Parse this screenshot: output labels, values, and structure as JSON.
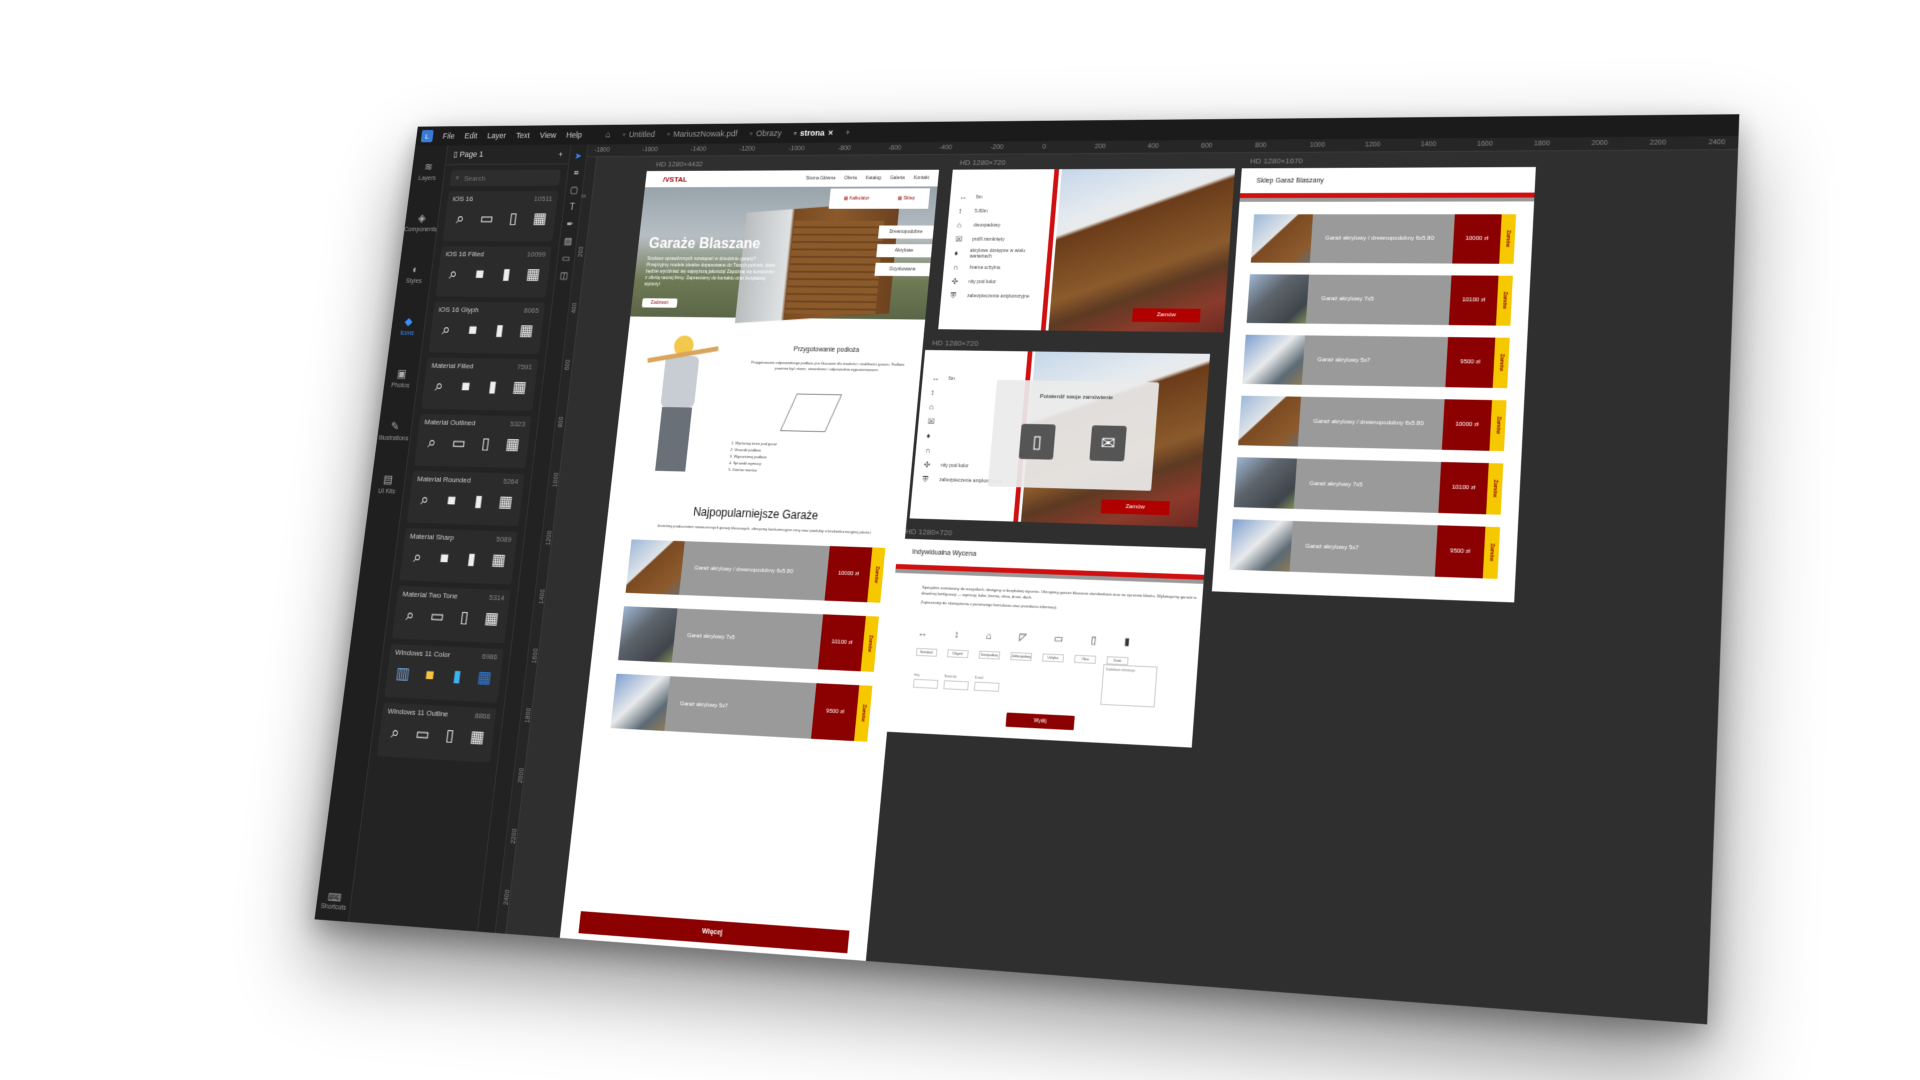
{
  "menu": {
    "items": [
      "File",
      "Edit",
      "Layer",
      "Text",
      "View",
      "Help"
    ]
  },
  "tabs": [
    {
      "label": "Untitled",
      "active": false
    },
    {
      "label": "MariuszNowak.pdf",
      "active": false
    },
    {
      "label": "Obrazy",
      "active": false
    },
    {
      "label": "strona",
      "active": true
    }
  ],
  "ruler": {
    "labels": [
      "-1800",
      "-1600",
      "-1400",
      "-1200",
      "-1000",
      "-800",
      "-600",
      "-400",
      "-200",
      "0",
      "200",
      "400",
      "600",
      "800",
      "1000",
      "1200",
      "1400",
      "1600",
      "1800",
      "2000",
      "2200",
      "2400"
    ]
  },
  "vruler": {
    "labels": [
      "0",
      "200",
      "400",
      "600",
      "800",
      "1000",
      "1200",
      "1400",
      "1600",
      "1800",
      "2000",
      "2200",
      "2400"
    ]
  },
  "rail": {
    "items": [
      {
        "label": "Layers",
        "icon": "layers-icon",
        "active": false
      },
      {
        "label": "Components",
        "icon": "components-icon",
        "active": false
      },
      {
        "label": "Styles",
        "icon": "styles-icon",
        "active": false
      },
      {
        "label": "Icons",
        "icon": "icons-icon",
        "active": true
      },
      {
        "label": "Photos",
        "icon": "photos-icon",
        "active": false
      },
      {
        "label": "Illustrations",
        "icon": "illustrations-icon",
        "active": false
      },
      {
        "label": "UI Kits",
        "icon": "ui-kits-icon",
        "active": false
      }
    ],
    "shortcuts": "Shortcuts"
  },
  "panel": {
    "page": "Page 1",
    "search_placeholder": "Search",
    "iconsets": [
      {
        "name": "iOS 16",
        "count": "10511",
        "glyphs": [
          "⌕",
          "▭",
          "▯",
          "▦"
        ]
      },
      {
        "name": "iOS 16 Filled",
        "count": "10099",
        "glyphs": [
          "⌕",
          "■",
          "▮",
          "▦"
        ]
      },
      {
        "name": "iOS 16 Glyph",
        "count": "8065",
        "glyphs": [
          "⌕",
          "■",
          "▮",
          "▦"
        ]
      },
      {
        "name": "Material Filled",
        "count": "7591",
        "glyphs": [
          "⌕",
          "■",
          "▮",
          "▦"
        ]
      },
      {
        "name": "Material Outlined",
        "count": "5323",
        "glyphs": [
          "⌕",
          "▭",
          "▯",
          "▦"
        ]
      },
      {
        "name": "Material Rounded",
        "count": "5264",
        "glyphs": [
          "⌕",
          "■",
          "▮",
          "▦"
        ]
      },
      {
        "name": "Material Sharp",
        "count": "5089",
        "glyphs": [
          "⌕",
          "■",
          "▮",
          "▦"
        ]
      },
      {
        "name": "Material Two Tone",
        "count": "5314",
        "glyphs": [
          "⌕",
          "▭",
          "▯",
          "▦"
        ]
      },
      {
        "name": "Windows 11 Color",
        "count": "6986",
        "glyphs": [
          "▥",
          "■",
          "▮",
          "▦"
        ]
      },
      {
        "name": "Windows 11 Outline",
        "count": "8868",
        "glyphs": [
          "⌕",
          "▭",
          "▯",
          "▦"
        ]
      }
    ]
  },
  "artboards": {
    "main": {
      "label": "HD 1280×4432",
      "nav": [
        "Strona Główna",
        "Oferta",
        "Katalog",
        "Galeria",
        "Kontakt"
      ],
      "quick": [
        "Kalkulator",
        "Sklep"
      ],
      "side_pills": [
        "Drewnopodobne",
        "Akrylowe",
        "Ocynkowane"
      ],
      "hero_title": "Garaże Blaszane",
      "hero_text": "Szukasz sprawdzonych rozwiązań w dziedzinie garaży? Przejrzyjmy modele idealne dopasowane do Twoich potrzeb, które będzie wyróżniać się najwyższą jakością! Zapoznaj się koniecznie z ofertą naszej firmy. Zapraszamy do kontaktu oraz bezpłatnej wyceny!",
      "hero_btn": "Zadzwoń",
      "prep_title": "Przygotowanie podłoża",
      "prep_text": "Przygotowanie odpowiedniego podłoża jest kluczowe dla trwałości i stabilności garażu. Podłoże powinno być równe, utwardzone i odpowiednio wypoziomowane.",
      "steps": [
        "1. Wyrównaj teren pod garaż",
        "2. Utwardź podłoże",
        "3. Wypoziomuj podłoże",
        "4. Sprawdź wymiary",
        "5. Zamów montaż"
      ],
      "section_title": "Najpopularniejsze Garaże",
      "section_sub": "Jesteśmy producentem nowoczesnych garaży blaszanych, oferujemy konkurencyjne ceny oraz produkty o bezkonkurencyjnej jakości",
      "products": [
        {
          "name": "Garaż akrylowy / drewnopodobny 6x5.80",
          "price": "10000 zł"
        },
        {
          "name": "Garaż akrylowy 7x5",
          "price": "10100 zł"
        },
        {
          "name": "Garaż akrylowy 5x7",
          "price": "9500 zł"
        }
      ],
      "order": "Zamów",
      "more": "Więcej"
    },
    "detail": {
      "label": "HD 1280×720",
      "specs": [
        "6m",
        "5.80m",
        "dwuspadowy",
        "profil zamknięty",
        "akrylowe dostępne w wielu wariantach",
        "brama uchylna",
        "nity pod kolor",
        "zabezpieczenie antykorozyjne"
      ],
      "order": "Zamów"
    },
    "detail2": {
      "label": "HD 1280×720",
      "specs": [
        "6m",
        "",
        "",
        "",
        "",
        "",
        "nity pod kolor",
        "zabezpieczenie antykorozyjne"
      ],
      "modal_title": "Potwierdź swoje zamówienie",
      "order": "Zamów"
    },
    "quote": {
      "label": "HD 1280×720",
      "title": "Indywidualna Wycena",
      "text": "Specjalnie zamówiony do wszystkich, dostępny w bezpłatnej wycenie. Oferujemy garaże blaszane standardowe oraz na życzenie klienta. Wykonujemy garaże w dowolnej konfiguracji — wymiary, kolor, brama, okna, drzwi, dach.",
      "text2": "Zapraszamy do skorzystania z poniższego formularza oraz przesłania informacji.",
      "tags": [
        "Szerokość",
        "Długość",
        "Dwuspadowy",
        "Jednospadowy",
        "Uchylna",
        "Okno",
        "Drzwi"
      ],
      "fields": [
        "Imię",
        "Nazwisko",
        "E-mail"
      ],
      "textarea": "Dodatkowe informacje",
      "send": "Wyślij"
    },
    "shop": {
      "label": "HD 1280×1670",
      "title": "Sklep Garaż Blaszany",
      "products": [
        {
          "name": "Garaż akrylowy / drewnopodobny 6x5.80",
          "price": "10000 zł"
        },
        {
          "name": "Garaż akrylowy 7x5",
          "price": "10100 zł"
        },
        {
          "name": "Garaż akrylowy 5x7",
          "price": "9500 zł"
        },
        {
          "name": "Garaż akrylowy / drewnopodobny 6x5.80",
          "price": "10000 zł"
        },
        {
          "name": "Garaż akrylowy 7x5",
          "price": "10100 zł"
        },
        {
          "name": "Garaż akrylowy 5x7",
          "price": "9500 zł"
        }
      ],
      "order": "Zamów"
    }
  },
  "colors": {
    "brand": "#8b0000",
    "accent": "#d01010",
    "order_tag": "#f5c800",
    "canvas": "#2f2f2f"
  }
}
